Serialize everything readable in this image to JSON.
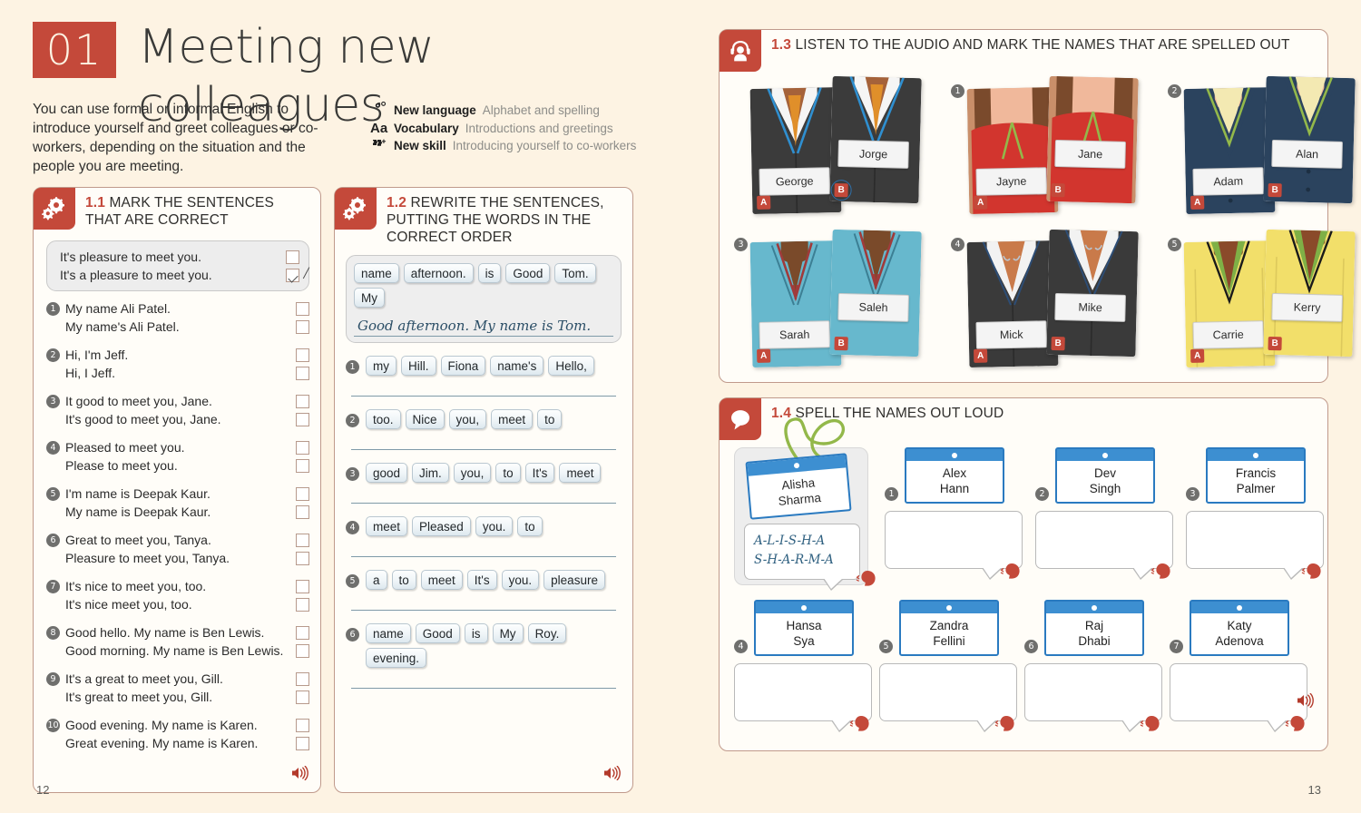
{
  "header": {
    "chapter_number": "01",
    "chapter_title": "Meeting new colleagues",
    "intro": "You can use formal or informal English to introduce yourself and greet colleagues or co-workers, depending on the situation and the people you are meeting.",
    "meta": [
      {
        "icon": "gear-icon",
        "label": "New language",
        "desc": "Alphabet and spelling"
      },
      {
        "icon": "aa-icon",
        "label": "Vocabulary",
        "desc": "Introductions and greetings"
      },
      {
        "icon": "puzzle-icon",
        "label": "New skill",
        "desc": "Introducing yourself to co-workers"
      }
    ]
  },
  "colors": {
    "accent_red": "#c4493a",
    "page_bg": "#fdf3e3",
    "panel_border": "#c09a8c",
    "chip_blue": "#2a7ac0"
  },
  "ex11": {
    "number": "1.1",
    "title": "MARK THE SENTENCES THAT ARE CORRECT",
    "icon": "gears-icon",
    "example": {
      "a": {
        "text": "It's pleasure to meet you.",
        "checked": false
      },
      "b": {
        "text": "It's a pleasure to meet you.",
        "checked": true
      }
    },
    "items": [
      {
        "n": "1",
        "a": "My name Ali Patel.",
        "b": "My name's Ali Patel."
      },
      {
        "n": "2",
        "a": "Hi, I'm Jeff.",
        "b": "Hi, I Jeff."
      },
      {
        "n": "3",
        "a": "It good to meet you, Jane.",
        "b": "It's good to meet you, Jane."
      },
      {
        "n": "4",
        "a": "Pleased to meet you.",
        "b": "Please to meet you."
      },
      {
        "n": "5",
        "a": "I'm name is Deepak Kaur.",
        "b": "My name is Deepak Kaur."
      },
      {
        "n": "6",
        "a": "Great to meet you, Tanya.",
        "b": "Pleasure to meet you, Tanya."
      },
      {
        "n": "7",
        "a": "It's nice to meet you, too.",
        "b": "It's nice meet you, too."
      },
      {
        "n": "8",
        "a": "Good hello. My name is Ben Lewis.",
        "b": "Good morning. My name is Ben Lewis."
      },
      {
        "n": "9",
        "a": "It's a great to meet you, Gill.",
        "b": "It's great to meet you, Gill."
      },
      {
        "n": "10",
        "a": "Good evening. My name is Karen.",
        "b": "Great evening. My name is Karen."
      }
    ],
    "audio_icon": "speaker-icon"
  },
  "ex12": {
    "number": "1.2",
    "title": "REWRITE THE SENTENCES, PUTTING THE WORDS IN THE CORRECT ORDER",
    "icon": "gears-icon",
    "example": {
      "chips": [
        "name",
        "afternoon.",
        "is",
        "Good",
        "Tom.",
        "My"
      ],
      "answer": "Good afternoon. My name is Tom."
    },
    "items": [
      {
        "n": "1",
        "chips": [
          "my",
          "Hill.",
          "Fiona",
          "name's",
          "Hello,"
        ]
      },
      {
        "n": "2",
        "chips": [
          "too.",
          "Nice",
          "you,",
          "meet",
          "to"
        ]
      },
      {
        "n": "3",
        "chips": [
          "good",
          "Jim.",
          "you,",
          "to",
          "It's",
          "meet"
        ]
      },
      {
        "n": "4",
        "chips": [
          "meet",
          "Pleased",
          "you.",
          "to"
        ]
      },
      {
        "n": "5",
        "chips": [
          "a",
          "to",
          "meet",
          "It's",
          "you.",
          "pleasure"
        ]
      },
      {
        "n": "6",
        "chips": [
          "name",
          "Good",
          "is",
          "My",
          "Roy.",
          "evening."
        ]
      }
    ],
    "audio_icon": "speaker-icon"
  },
  "ex13": {
    "number": "1.3",
    "title": "LISTEN TO THE AUDIO AND MARK THE NAMES THAT ARE SPELLED OUT",
    "icon": "headphones-icon",
    "items": [
      {
        "n": "",
        "example": true,
        "a": "George",
        "b": "Jorge",
        "selected": "B",
        "suit": "dark-suit-blue-lanyard",
        "jacket": "#3b3b3b",
        "shirt": "#f5f5f5",
        "tie": "#e08f2a",
        "lanyard": "#2f8fd0",
        "skin": "#a5623a"
      },
      {
        "n": "1",
        "example": false,
        "a": "Jayne",
        "b": "Jane",
        "selected": "",
        "suit": "red-top",
        "jacket": "#d2352e",
        "shirt": "#d2352e",
        "tie": "",
        "lanyard": "#93b84a",
        "skin": "#f0b89b"
      },
      {
        "n": "2",
        "example": false,
        "a": "Adam",
        "b": "Alan",
        "selected": "",
        "suit": "navy-suit",
        "jacket": "#2b435e",
        "shirt": "#f3e9b2",
        "tie": "",
        "lanyard": "#93b84a",
        "skin": "#f0b89b"
      },
      {
        "n": "3",
        "example": false,
        "a": "Sarah",
        "b": "Saleh",
        "selected": "",
        "suit": "teal-scrubs",
        "jacket": "#67b8cd",
        "shirt": "#67b8cd",
        "tie": "",
        "lanyard": "#a03b3b",
        "skin": "#7a4a2a"
      },
      {
        "n": "4",
        "example": false,
        "a": "Mick",
        "b": "Mike",
        "selected": "",
        "suit": "black-suit-white-shirt",
        "jacket": "#3a3a3a",
        "shirt": "#f2f2f2",
        "tie": "",
        "lanyard": "#2d4d75",
        "skin": "#c97a4a"
      },
      {
        "n": "5",
        "example": false,
        "a": "Carrie",
        "b": "Kerry",
        "selected": "",
        "suit": "yellow-top-green-vest",
        "jacket": "#f2df6a",
        "shirt": "#7fb046",
        "tie": "",
        "lanyard": "#1a1a1a",
        "skin": "#8a4a2a"
      }
    ]
  },
  "ex14": {
    "number": "1.4",
    "title": "SPELL THE NAMES OUT LOUD",
    "icon": "speech-bubble-icon",
    "example": {
      "name_line1": "Alisha",
      "name_line2": "Sharma",
      "spelling_line1": "A-L-I-S-H-A",
      "spelling_line2": "S-H-A-R-M-A"
    },
    "items": [
      {
        "n": "1",
        "line1": "Alex",
        "line2": "Hann"
      },
      {
        "n": "2",
        "line1": "Dev",
        "line2": "Singh"
      },
      {
        "n": "3",
        "line1": "Francis",
        "line2": "Palmer"
      },
      {
        "n": "4",
        "line1": "Hansa",
        "line2": "Sya"
      },
      {
        "n": "5",
        "line1": "Zandra",
        "line2": "Fellini"
      },
      {
        "n": "6",
        "line1": "Raj",
        "line2": "Dhabi"
      },
      {
        "n": "7",
        "line1": "Katy",
        "line2": "Adenova"
      }
    ],
    "audio_icon": "speaker-icon",
    "speak_icon": "speaking-head-icon"
  },
  "footer": {
    "page_left": "12",
    "page_right": "13"
  }
}
